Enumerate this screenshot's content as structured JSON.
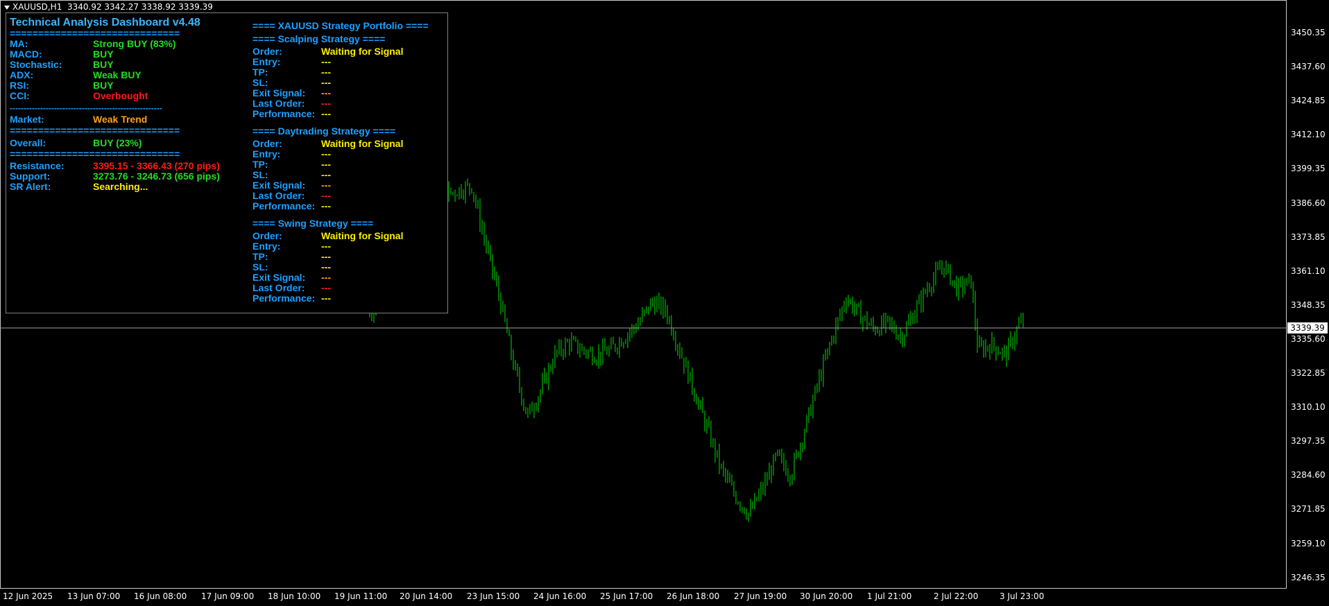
{
  "header": {
    "symbol": "XAUUSD,H1",
    "ohlc": "3340.92 3342.27 3338.92 3339.39"
  },
  "price_axis": {
    "labels": [
      "3450.35",
      "3437.60",
      "3424.85",
      "3412.10",
      "3399.35",
      "3386.60",
      "3373.85",
      "3361.10",
      "3348.35",
      "3335.60",
      "3322.85",
      "3310.10",
      "3297.35",
      "3284.60",
      "3271.85",
      "3259.10",
      "3246.35"
    ],
    "current_price": "3339.39",
    "min": 3240,
    "max": 3462
  },
  "time_axis": {
    "labels": [
      "12 Jun 2025",
      "13 Jun 07:00",
      "16 Jun 08:00",
      "17 Jun 09:00",
      "18 Jun 10:00",
      "19 Jun 11:00",
      "20 Jun 14:00",
      "23 Jun 15:00",
      "24 Jun 16:00",
      "25 Jun 17:00",
      "26 Jun 18:00",
      "27 Jun 19:00",
      "30 Jun 20:00",
      "1 Jul 21:00",
      "2 Jul 22:00",
      "3 Jul 23:00"
    ]
  },
  "colors": {
    "candle": "#00e000",
    "price_line": "#a0a0a0",
    "border": "#c8c8c8"
  },
  "dashboard": {
    "title": "Technical Analysis Dashboard v4.48",
    "separator_eq": "==============================",
    "separator_dash": "-------------------------------------------------------",
    "indicators": [
      {
        "label": "MA:",
        "value": "Strong BUY (83%)"
      },
      {
        "label": "MACD:",
        "value": "BUY"
      },
      {
        "label": "Stochastic:",
        "value": "BUY"
      },
      {
        "label": "ADX:",
        "value": "Weak BUY"
      },
      {
        "label": "RSI:",
        "value": "BUY"
      },
      {
        "label": "CCI:",
        "value": "Overbought"
      }
    ],
    "market": {
      "label": "Market:",
      "value": "Weak Trend"
    },
    "overall": {
      "label": "Overall:",
      "value": "BUY (23%)"
    },
    "sr": [
      {
        "label": "Resistance:",
        "value": "3395.15 - 3366.43 (270 pips)"
      },
      {
        "label": "Support:",
        "value": "3273.76 - 3246.73 (656 pips)"
      },
      {
        "label": "SR Alert:",
        "value": "Searching..."
      }
    ],
    "portfolio_title": "==== XAUUSD Strategy Portfolio ====",
    "strategies": [
      {
        "title": "==== Scalping Strategy ====",
        "rows": [
          {
            "label": "Order:",
            "value": "Waiting for Signal"
          },
          {
            "label": "Entry:",
            "value": "---"
          },
          {
            "label": "TP:",
            "value": "---"
          },
          {
            "label": "SL:",
            "value": "---"
          },
          {
            "label": "Exit Signal:",
            "value": "---"
          },
          {
            "label": "Last Order:",
            "value": "---"
          },
          {
            "label": "Performance:",
            "value": "---"
          }
        ]
      },
      {
        "title": "==== Daytrading Strategy ====",
        "rows": [
          {
            "label": "Order:",
            "value": "Waiting for Signal"
          },
          {
            "label": "Entry:",
            "value": "---"
          },
          {
            "label": "TP:",
            "value": "---"
          },
          {
            "label": "SL:",
            "value": "---"
          },
          {
            "label": "Exit Signal:",
            "value": "---"
          },
          {
            "label": "Last Order:",
            "value": "---"
          },
          {
            "label": "Performance:",
            "value": "---"
          }
        ]
      },
      {
        "title": "==== Swing Strategy ====",
        "rows": [
          {
            "label": "Order:",
            "value": "Waiting for Signal"
          },
          {
            "label": "Entry:",
            "value": "---"
          },
          {
            "label": "TP:",
            "value": "---"
          },
          {
            "label": "SL:",
            "value": "---"
          },
          {
            "label": "Exit Signal:",
            "value": "---"
          },
          {
            "label": "Last Order:",
            "value": "---"
          },
          {
            "label": "Performance:",
            "value": "---"
          }
        ]
      }
    ]
  }
}
